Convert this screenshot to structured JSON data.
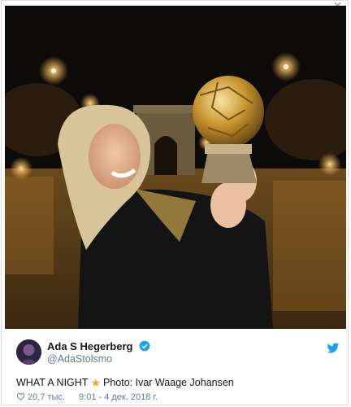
{
  "tweet": {
    "author_name": "Ada S Hegerberg",
    "author_handle": "@AdaStolsmo",
    "text_before": "WHAT A NIGHT",
    "text_after": "Photo: Ivar Waage Johansen",
    "likes": "20,7 тыс.",
    "timestamp": "9:01 - 4 дек. 2018 г."
  },
  "colors": {
    "link_blue": "#1da1f2",
    "muted": "#657786",
    "star": "#f2a72c"
  },
  "icons": [
    "chevron-down-icon",
    "verified-badge-icon",
    "twitter-bird-icon",
    "star-emoji-icon",
    "heart-icon"
  ]
}
